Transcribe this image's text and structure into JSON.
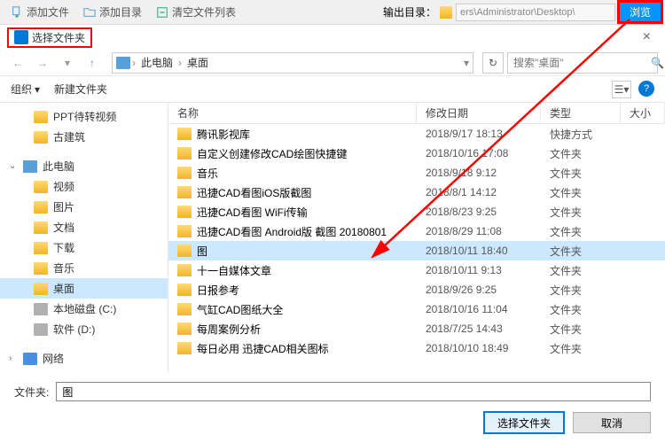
{
  "toolbar": {
    "add_file": "添加文件",
    "add_dir": "添加目录",
    "clear_list": "清空文件列表",
    "output_label": "输出目录：",
    "output_path": "ers\\Administrator\\Desktop\\",
    "browse": "浏览"
  },
  "dialog": {
    "title": "选择文件夹",
    "close": "×"
  },
  "nav": {
    "breadcrumb": [
      "此电脑",
      "桌面"
    ],
    "search_placeholder": "搜索\"桌面\"",
    "refresh_glyph": "↻"
  },
  "controls": {
    "organize": "组织",
    "new_folder": "新建文件夹"
  },
  "tree": [
    {
      "label": "PPT待转视频",
      "icon": "folder",
      "level": 1
    },
    {
      "label": "古建筑",
      "icon": "folder",
      "level": 1
    },
    {
      "label": "此电脑",
      "icon": "pc",
      "level": 0,
      "expandable": true,
      "expanded": true
    },
    {
      "label": "视频",
      "icon": "folder",
      "level": 1
    },
    {
      "label": "图片",
      "icon": "folder",
      "level": 1
    },
    {
      "label": "文档",
      "icon": "folder",
      "level": 1
    },
    {
      "label": "下载",
      "icon": "folder",
      "level": 1
    },
    {
      "label": "音乐",
      "icon": "folder",
      "level": 1
    },
    {
      "label": "桌面",
      "icon": "folder",
      "level": 1,
      "selected": true
    },
    {
      "label": "本地磁盘 (C:)",
      "icon": "disk",
      "level": 1
    },
    {
      "label": "软件 (D:)",
      "icon": "disk",
      "level": 1
    },
    {
      "label": "网络",
      "icon": "net",
      "level": 0,
      "expandable": true
    }
  ],
  "columns": {
    "name": "名称",
    "date": "修改日期",
    "type": "类型",
    "size": "大小"
  },
  "files": [
    {
      "name": "腾讯影视库",
      "date": "2018/9/17 18:13",
      "type": "快捷方式"
    },
    {
      "name": "自定义创建修改CAD绘图快捷键",
      "date": "2018/10/16 17:08",
      "type": "文件夹"
    },
    {
      "name": "音乐",
      "date": "2018/9/18 9:12",
      "type": "文件夹"
    },
    {
      "name": "迅捷CAD看图iOS版截图",
      "date": "2018/8/1 14:12",
      "type": "文件夹"
    },
    {
      "name": "迅捷CAD看图 WiFi传输",
      "date": "2018/8/23 9:25",
      "type": "文件夹"
    },
    {
      "name": "迅捷CAD看图 Android版 截图 20180801",
      "date": "2018/8/29 11:08",
      "type": "文件夹"
    },
    {
      "name": "图",
      "date": "2018/10/11 18:40",
      "type": "文件夹",
      "selected": true
    },
    {
      "name": "十一自媒体文章",
      "date": "2018/10/11 9:13",
      "type": "文件夹"
    },
    {
      "name": "日报参考",
      "date": "2018/9/26 9:25",
      "type": "文件夹"
    },
    {
      "name": "气缸CAD图纸大全",
      "date": "2018/10/16 11:04",
      "type": "文件夹"
    },
    {
      "name": "每周案例分析",
      "date": "2018/7/25 14:43",
      "type": "文件夹"
    },
    {
      "name": "每日必用 迅捷CAD相关图标",
      "date": "2018/10/10 18:49",
      "type": "文件夹"
    }
  ],
  "footer": {
    "folder_label": "文件夹:",
    "folder_value": "图",
    "select_btn": "选择文件夹",
    "cancel_btn": "取消"
  }
}
